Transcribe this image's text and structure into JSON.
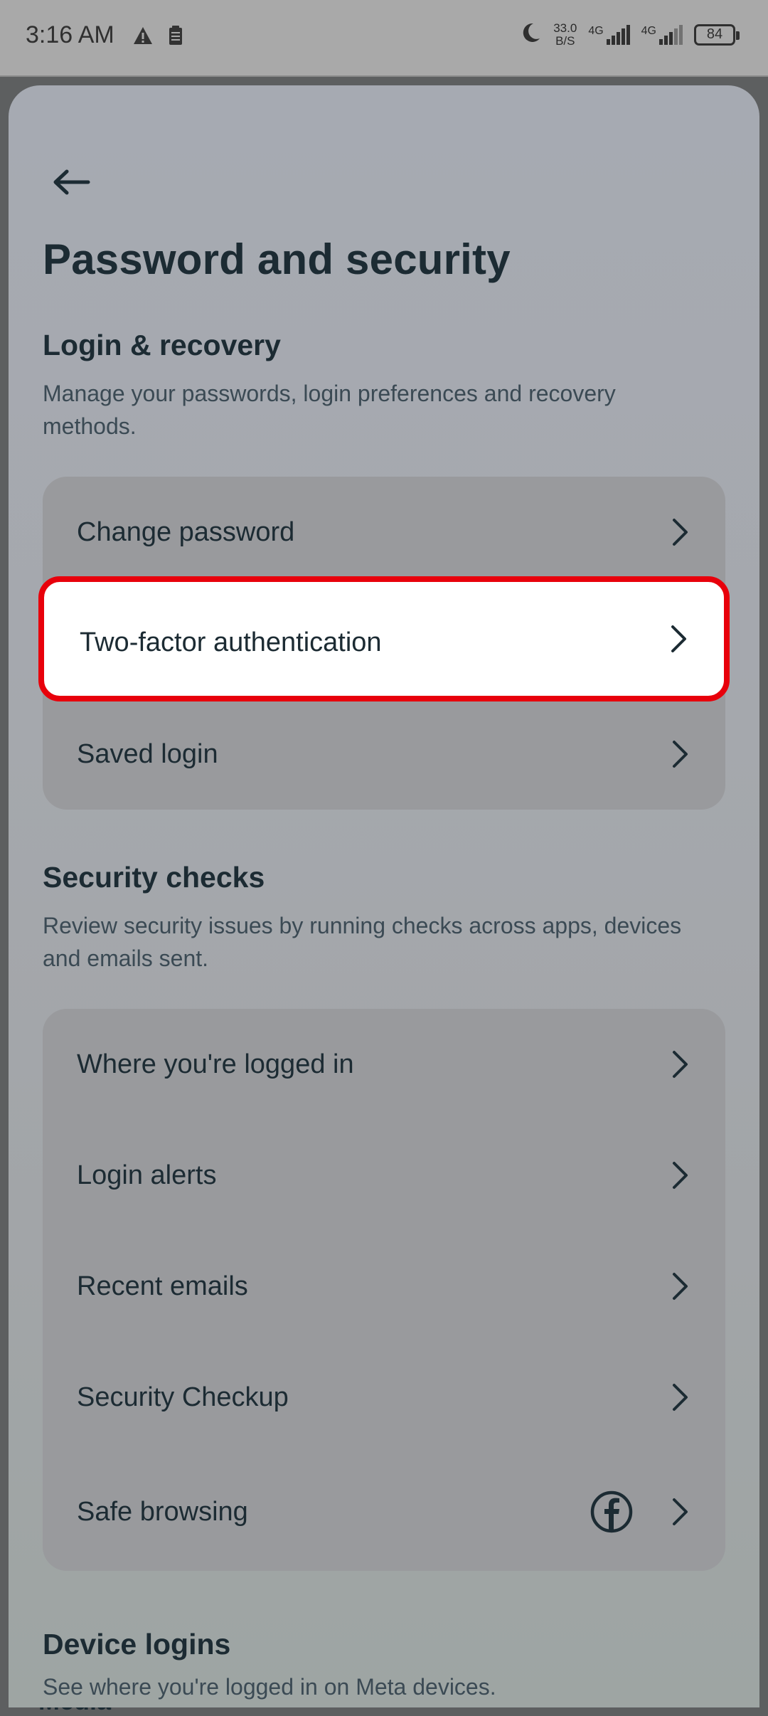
{
  "status_bar": {
    "time": "3:16 AM",
    "net_speed_value": "33.0",
    "net_speed_unit": "B/S",
    "signal1_label": "4G",
    "signal2_label": "4G",
    "battery": "84"
  },
  "header": {
    "title": "Password and security"
  },
  "login_recovery": {
    "title": "Login & recovery",
    "description": "Manage your passwords, login preferences and recovery methods.",
    "items": [
      {
        "label": "Change password"
      },
      {
        "label": "Two-factor authentication"
      },
      {
        "label": "Saved login"
      }
    ]
  },
  "security_checks": {
    "title": "Security checks",
    "description": "Review security issues by running checks across apps, devices and emails sent.",
    "items": [
      {
        "label": "Where you're logged in"
      },
      {
        "label": "Login alerts"
      },
      {
        "label": "Recent emails"
      },
      {
        "label": "Security Checkup"
      },
      {
        "label": "Safe browsing"
      }
    ]
  },
  "device_logins": {
    "title": "Device logins",
    "description": "See where you're logged in on Meta devices.",
    "background_peek_label": "Media"
  },
  "colors": {
    "highlight_border": "#e8000b",
    "text_primary": "#1c2b33"
  }
}
